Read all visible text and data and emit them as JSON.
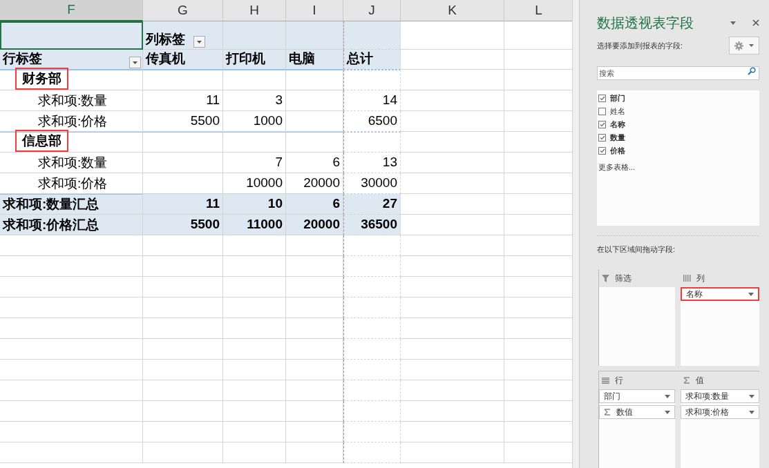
{
  "sheet": {
    "column_headers": [
      {
        "label": "F",
        "selected": true
      },
      {
        "label": "G",
        "selected": false
      },
      {
        "label": "H",
        "selected": false
      },
      {
        "label": "I",
        "selected": false
      },
      {
        "label": "J",
        "selected": false
      },
      {
        "label": "K",
        "selected": false
      },
      {
        "label": "L",
        "selected": false
      }
    ],
    "column_label": "列标签",
    "row_label": "行标签",
    "columns": [
      "传真机",
      "打印机",
      "电脑",
      "总计"
    ],
    "groups": [
      {
        "name": "财务部",
        "highlighted": true,
        "rows": [
          {
            "label": "求和项:数量",
            "column_1": "11",
            "column_2": "3",
            "column_4": "14"
          },
          {
            "label": "求和项:价格",
            "column_1": "5500",
            "column_2": "1000",
            "column_4": "6500"
          }
        ]
      },
      {
        "name": "信息部",
        "highlighted": true,
        "rows": [
          {
            "label": "求和项:数量",
            "column_2": "7",
            "column_3": "6",
            "column_4": "13"
          },
          {
            "label": "求和项:价格",
            "column_2": "10000",
            "column_3": "20000",
            "column_4": "30000"
          }
        ]
      }
    ],
    "totals": [
      {
        "label": "求和项:数量汇总",
        "column_1": "11",
        "column_2": "10",
        "column_3": "6",
        "column_4": "27"
      },
      {
        "label": "求和项:价格汇总",
        "column_1": "5500",
        "column_2": "11000",
        "column_3": "20000",
        "column_4": "36500"
      }
    ]
  },
  "panel": {
    "title": "数据透视表字段",
    "fields_caption": "选择要添加到报表的字段:",
    "search": {
      "placeholder": "搜索"
    },
    "fields": [
      {
        "label": "部门",
        "checked": true
      },
      {
        "label": "姓名",
        "checked": false
      },
      {
        "label": "名称",
        "checked": true
      },
      {
        "label": "数量",
        "checked": true
      },
      {
        "label": "价格",
        "checked": true
      }
    ],
    "more_tables": "更多表格...",
    "areas_caption": "在以下区域间拖动字段:",
    "areas": [
      {
        "kind": "filter",
        "label": "筛选"
      },
      {
        "kind": "columns",
        "label": "列",
        "items": [
          {
            "label": "名称",
            "highlighted": true,
            "sigma": false
          }
        ]
      },
      {
        "kind": "rows",
        "label": "行",
        "items": [
          {
            "label": "部门",
            "highlighted": false,
            "sigma": false
          },
          {
            "label": "数值",
            "highlighted": false,
            "sigma": true
          }
        ]
      },
      {
        "kind": "values",
        "label": "值",
        "items": [
          {
            "label": "求和项:数量",
            "highlighted": false,
            "sigma": false
          },
          {
            "label": "求和项:价格",
            "highlighted": false,
            "sigma": false
          }
        ]
      }
    ]
  }
}
